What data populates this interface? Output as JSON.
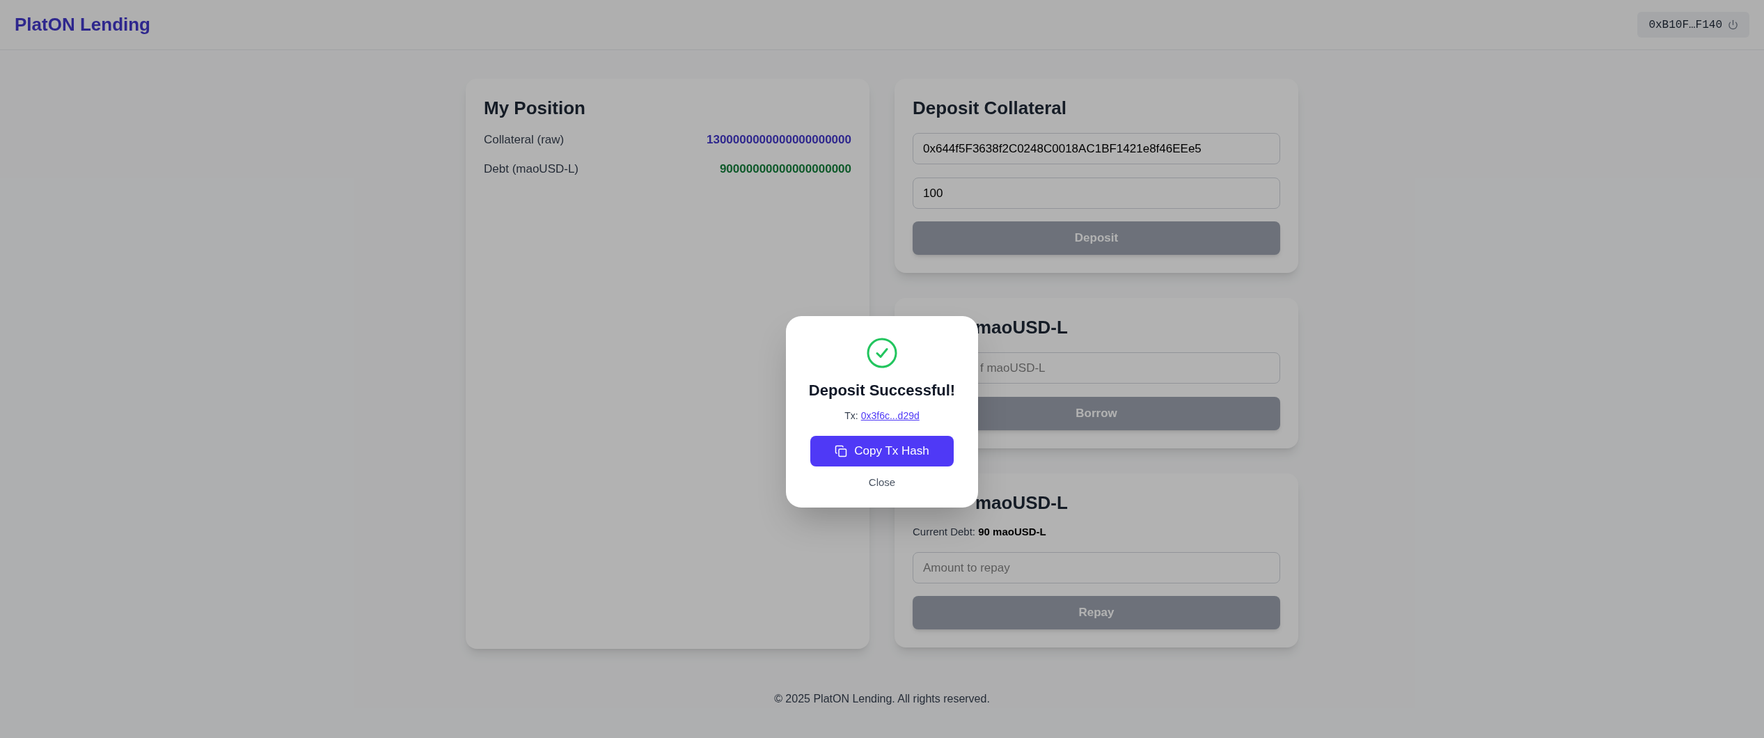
{
  "header": {
    "logo": "PlatON Lending",
    "wallet": {
      "address": "0xB10F…F140"
    }
  },
  "position": {
    "title": "My Position",
    "rows": [
      {
        "kind": "collateral",
        "label": "Collateral (raw)",
        "value": "1300000000000000000000"
      },
      {
        "kind": "debt",
        "label": "Debt (maoUSD-L)",
        "value": "90000000000000000000"
      }
    ]
  },
  "deposit": {
    "title": "Deposit Collateral",
    "fields": [
      {
        "value": "0x644f5F3638f2C0248C0018AC1BF1421e8f46EEe5"
      },
      {
        "value": "100"
      }
    ],
    "button": {
      "label": "Deposit",
      "disabled": true
    }
  },
  "borrow": {
    "title": "maoUSD-L",
    "field": {
      "placeholder": "f maoUSD-L"
    },
    "button": {
      "label": "Borrow",
      "disabled": true
    }
  },
  "repay": {
    "title": "maoUSD-L",
    "current_debt": "Current Debt: **90 maoUSD-L**",
    "field": {
      "placeholder": "Amount to repay"
    },
    "button": {
      "label": "Repay",
      "disabled": true
    }
  },
  "modal": {
    "title": "Deposit Successful!",
    "tx_label": "Tx:",
    "tx_link": "0x3f6c...d29d",
    "copy_button": "Copy Tx Hash",
    "close": "Close"
  },
  "footer": "© 2025 PlatON Lending. All rights reserved."
}
